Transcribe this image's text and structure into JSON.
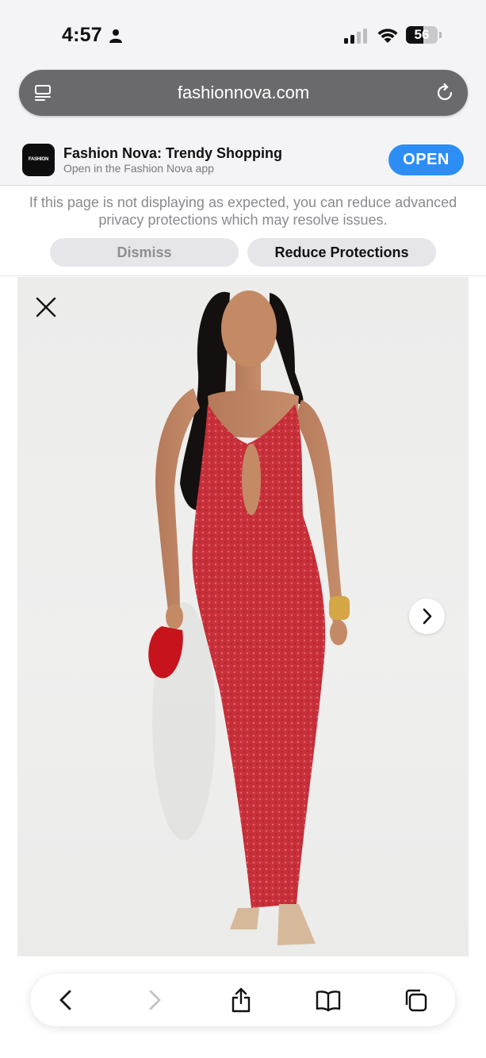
{
  "status_bar": {
    "time": "4:57",
    "battery_level": 56,
    "battery_label": "56",
    "icons": [
      "person-icon",
      "signal-icon",
      "wifi-icon",
      "battery-icon"
    ]
  },
  "address_bar": {
    "url": "fashionnova.com",
    "icons": [
      "reader-icon",
      "reload-icon"
    ]
  },
  "app_banner": {
    "logo_text": "FASHION NOVA",
    "title": "Fashion Nova: Trendy Shopping",
    "subtitle": "Open in the Fashion Nova app",
    "open_label": "OPEN"
  },
  "privacy_notice": {
    "message": "If this page is not displaying as expected, you can reduce advanced privacy protections which may resolve issues.",
    "dismiss_label": "Dismiss",
    "reduce_label": "Reduce Protections"
  },
  "gallery": {
    "icons": [
      "close-icon",
      "chevron-right-icon"
    ]
  },
  "toolbar": {
    "icons": [
      "back-icon",
      "forward-icon",
      "share-icon",
      "bookmarks-icon",
      "tabs-icon"
    ]
  },
  "colors": {
    "accent_blue": "#2c8ef4",
    "dress_red": "#c8303a",
    "address_bar_gray": "#6a6a6c"
  }
}
